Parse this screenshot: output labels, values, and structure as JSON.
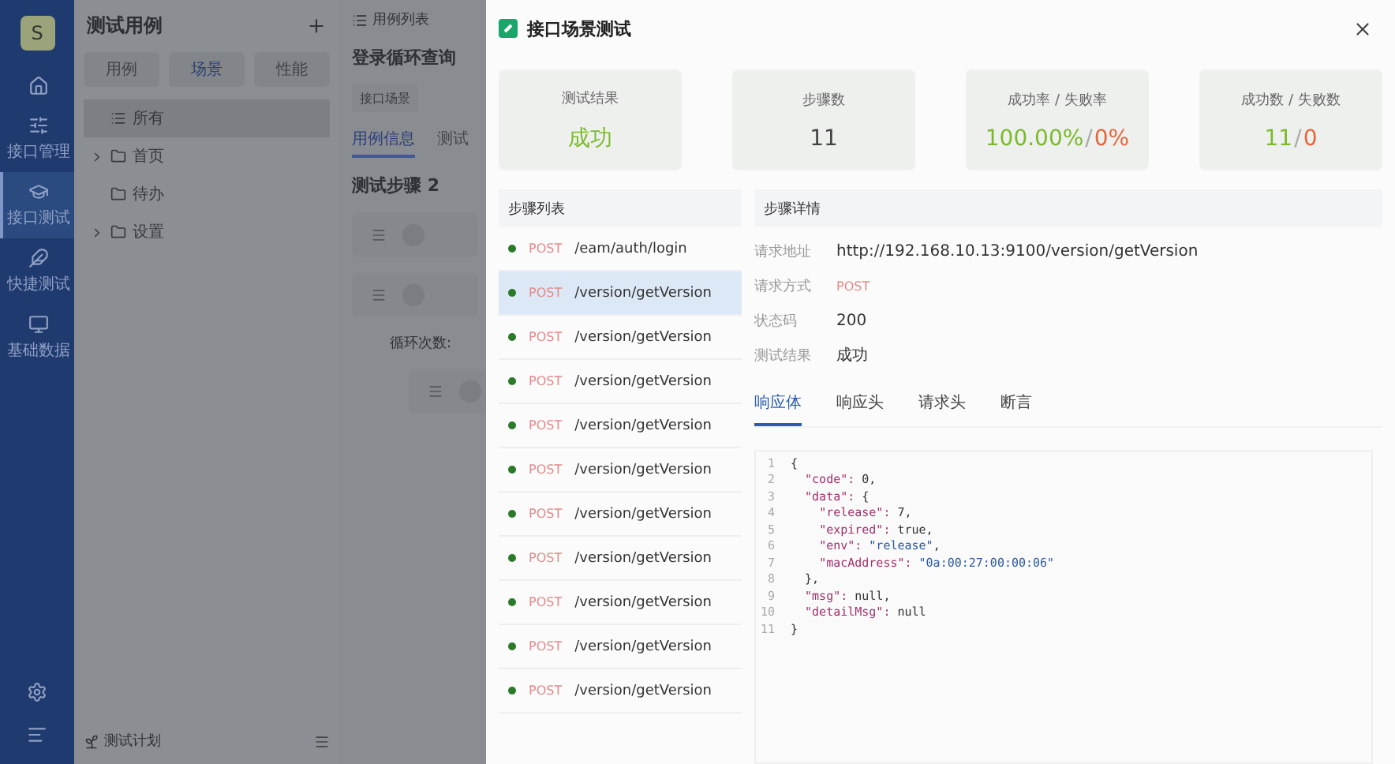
{
  "nav": {
    "avatar": "S",
    "items": [
      {
        "selected": false
      },
      {
        "label": "接口管理",
        "selected": false
      },
      {
        "label": "接口测试",
        "selected": true
      },
      {
        "label": "快捷测试",
        "selected": false
      },
      {
        "label": "基础数据",
        "selected": false
      }
    ]
  },
  "case_panel": {
    "title": "测试用例",
    "tabs": [
      {
        "label": "用例",
        "selected": false
      },
      {
        "label": "场景",
        "selected": true
      },
      {
        "label": "性能",
        "selected": false
      }
    ],
    "tree": [
      {
        "kind": "all",
        "label": "所有",
        "selected": true
      },
      {
        "kind": "group",
        "label": "首页",
        "expanded": false,
        "selected": false
      },
      {
        "kind": "folder",
        "label": "待办",
        "selected": false
      },
      {
        "kind": "group",
        "label": "设置",
        "expanded": false,
        "selected": false
      }
    ],
    "footer": "测试计划"
  },
  "main": {
    "header": "用例列表",
    "title": "登录循环查询",
    "tag": "接口场景",
    "tabs": [
      {
        "label": "用例信息",
        "selected": true
      },
      {
        "label": "测试",
        "selected": false
      }
    ],
    "section": "测试步骤 2",
    "loop_label": "循环次数:"
  },
  "drawer": {
    "title": "接口场景测试",
    "stats": [
      {
        "label": "测试结果",
        "parts": [
          {
            "text": "成功",
            "kind": "success"
          }
        ]
      },
      {
        "label": "步骤数",
        "parts": [
          {
            "text": "11",
            "kind": "neutral"
          }
        ]
      },
      {
        "label": "成功率 / 失败率",
        "parts": [
          {
            "text": "100.00%",
            "kind": "success"
          },
          {
            "text": "/",
            "kind": "separator"
          },
          {
            "text": "0%",
            "kind": "fail"
          }
        ]
      },
      {
        "label": "成功数 / 失败数",
        "parts": [
          {
            "text": "11",
            "kind": "success"
          },
          {
            "text": "/",
            "kind": "separator"
          },
          {
            "text": "0",
            "kind": "fail"
          }
        ]
      }
    ],
    "steps_title": "步骤列表",
    "steps": [
      {
        "method": "POST",
        "path": "/eam/auth/login",
        "passed": true,
        "selected": false
      },
      {
        "method": "POST",
        "path": "/version/getVersion",
        "passed": true,
        "selected": true
      },
      {
        "method": "POST",
        "path": "/version/getVersion",
        "passed": true,
        "selected": false
      },
      {
        "method": "POST",
        "path": "/version/getVersion",
        "passed": true,
        "selected": false
      },
      {
        "method": "POST",
        "path": "/version/getVersion",
        "passed": true,
        "selected": false
      },
      {
        "method": "POST",
        "path": "/version/getVersion",
        "passed": true,
        "selected": false
      },
      {
        "method": "POST",
        "path": "/version/getVersion",
        "passed": true,
        "selected": false
      },
      {
        "method": "POST",
        "path": "/version/getVersion",
        "passed": true,
        "selected": false
      },
      {
        "method": "POST",
        "path": "/version/getVersion",
        "passed": true,
        "selected": false
      },
      {
        "method": "POST",
        "path": "/version/getVersion",
        "passed": true,
        "selected": false
      },
      {
        "method": "POST",
        "path": "/version/getVersion",
        "passed": true,
        "selected": false
      }
    ],
    "detail_title": "步骤详情",
    "fields": [
      {
        "label": "请求地址",
        "value": "http://192.168.10.13:9100/version/getVersion",
        "kind": "text"
      },
      {
        "label": "请求方式",
        "value": "POST",
        "kind": "method"
      },
      {
        "label": "状态码",
        "value": "200",
        "kind": "text"
      },
      {
        "label": "测试结果",
        "value": "成功",
        "kind": "text"
      }
    ],
    "detail_tabs": [
      {
        "label": "响应体",
        "selected": true
      },
      {
        "label": "响应头",
        "selected": false
      },
      {
        "label": "请求头",
        "selected": false
      },
      {
        "label": "断言",
        "selected": false
      }
    ],
    "code": [
      {
        "no": "1",
        "text": "{"
      },
      {
        "no": "2",
        "text": "  \"code\": 0,"
      },
      {
        "no": "3",
        "text": "  \"data\": {"
      },
      {
        "no": "4",
        "text": "    \"release\": 7,"
      },
      {
        "no": "5",
        "text": "    \"expired\": true,"
      },
      {
        "no": "6",
        "text": "    \"env\": \"release\","
      },
      {
        "no": "7",
        "text": "    \"macAddress\": \"0a:00:27:00:00:06\""
      },
      {
        "no": "8",
        "text": "  },"
      },
      {
        "no": "9",
        "text": "  \"msg\": null,"
      },
      {
        "no": "10",
        "text": "  \"detailMsg\": null"
      },
      {
        "no": "11",
        "text": "}"
      }
    ]
  }
}
